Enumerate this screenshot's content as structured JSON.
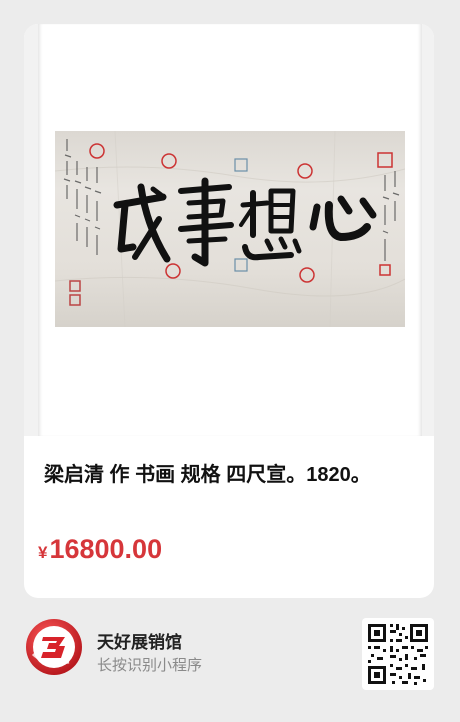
{
  "product": {
    "title": "梁启清 作 书画 规格 四尺宣。1820。",
    "price_symbol": "¥",
    "price_value": "16800.00"
  },
  "artwork": {
    "calligraphy_text": "心想事成"
  },
  "footer": {
    "store_name": "天好展销馆",
    "hint_text": "长按识别小程序",
    "logo_icon": "store-logo-icon",
    "qr_icon": "mini-program-qr-icon"
  },
  "colors": {
    "price": "#d6363a",
    "logo_red": "#d8232a",
    "background": "#ececec"
  }
}
